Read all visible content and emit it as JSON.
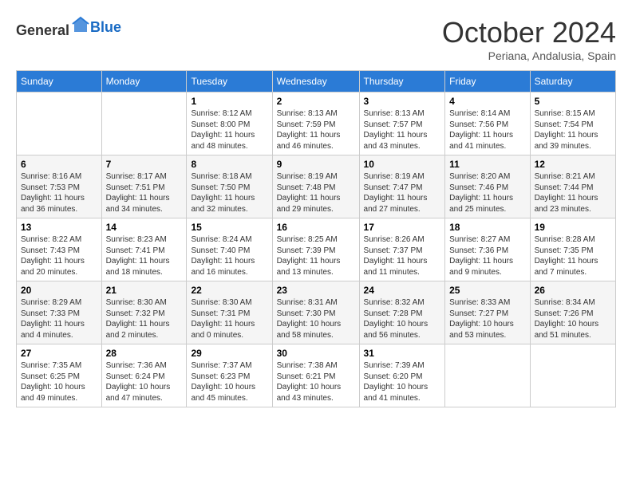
{
  "logo": {
    "text_general": "General",
    "text_blue": "Blue"
  },
  "header": {
    "month": "October 2024",
    "location": "Periana, Andalusia, Spain"
  },
  "columns": [
    "Sunday",
    "Monday",
    "Tuesday",
    "Wednesday",
    "Thursday",
    "Friday",
    "Saturday"
  ],
  "weeks": [
    [
      {
        "day": "",
        "info": ""
      },
      {
        "day": "",
        "info": ""
      },
      {
        "day": "1",
        "info": "Sunrise: 8:12 AM\nSunset: 8:00 PM\nDaylight: 11 hours and 48 minutes."
      },
      {
        "day": "2",
        "info": "Sunrise: 8:13 AM\nSunset: 7:59 PM\nDaylight: 11 hours and 46 minutes."
      },
      {
        "day": "3",
        "info": "Sunrise: 8:13 AM\nSunset: 7:57 PM\nDaylight: 11 hours and 43 minutes."
      },
      {
        "day": "4",
        "info": "Sunrise: 8:14 AM\nSunset: 7:56 PM\nDaylight: 11 hours and 41 minutes."
      },
      {
        "day": "5",
        "info": "Sunrise: 8:15 AM\nSunset: 7:54 PM\nDaylight: 11 hours and 39 minutes."
      }
    ],
    [
      {
        "day": "6",
        "info": "Sunrise: 8:16 AM\nSunset: 7:53 PM\nDaylight: 11 hours and 36 minutes."
      },
      {
        "day": "7",
        "info": "Sunrise: 8:17 AM\nSunset: 7:51 PM\nDaylight: 11 hours and 34 minutes."
      },
      {
        "day": "8",
        "info": "Sunrise: 8:18 AM\nSunset: 7:50 PM\nDaylight: 11 hours and 32 minutes."
      },
      {
        "day": "9",
        "info": "Sunrise: 8:19 AM\nSunset: 7:48 PM\nDaylight: 11 hours and 29 minutes."
      },
      {
        "day": "10",
        "info": "Sunrise: 8:19 AM\nSunset: 7:47 PM\nDaylight: 11 hours and 27 minutes."
      },
      {
        "day": "11",
        "info": "Sunrise: 8:20 AM\nSunset: 7:46 PM\nDaylight: 11 hours and 25 minutes."
      },
      {
        "day": "12",
        "info": "Sunrise: 8:21 AM\nSunset: 7:44 PM\nDaylight: 11 hours and 23 minutes."
      }
    ],
    [
      {
        "day": "13",
        "info": "Sunrise: 8:22 AM\nSunset: 7:43 PM\nDaylight: 11 hours and 20 minutes."
      },
      {
        "day": "14",
        "info": "Sunrise: 8:23 AM\nSunset: 7:41 PM\nDaylight: 11 hours and 18 minutes."
      },
      {
        "day": "15",
        "info": "Sunrise: 8:24 AM\nSunset: 7:40 PM\nDaylight: 11 hours and 16 minutes."
      },
      {
        "day": "16",
        "info": "Sunrise: 8:25 AM\nSunset: 7:39 PM\nDaylight: 11 hours and 13 minutes."
      },
      {
        "day": "17",
        "info": "Sunrise: 8:26 AM\nSunset: 7:37 PM\nDaylight: 11 hours and 11 minutes."
      },
      {
        "day": "18",
        "info": "Sunrise: 8:27 AM\nSunset: 7:36 PM\nDaylight: 11 hours and 9 minutes."
      },
      {
        "day": "19",
        "info": "Sunrise: 8:28 AM\nSunset: 7:35 PM\nDaylight: 11 hours and 7 minutes."
      }
    ],
    [
      {
        "day": "20",
        "info": "Sunrise: 8:29 AM\nSunset: 7:33 PM\nDaylight: 11 hours and 4 minutes."
      },
      {
        "day": "21",
        "info": "Sunrise: 8:30 AM\nSunset: 7:32 PM\nDaylight: 11 hours and 2 minutes."
      },
      {
        "day": "22",
        "info": "Sunrise: 8:30 AM\nSunset: 7:31 PM\nDaylight: 11 hours and 0 minutes."
      },
      {
        "day": "23",
        "info": "Sunrise: 8:31 AM\nSunset: 7:30 PM\nDaylight: 10 hours and 58 minutes."
      },
      {
        "day": "24",
        "info": "Sunrise: 8:32 AM\nSunset: 7:28 PM\nDaylight: 10 hours and 56 minutes."
      },
      {
        "day": "25",
        "info": "Sunrise: 8:33 AM\nSunset: 7:27 PM\nDaylight: 10 hours and 53 minutes."
      },
      {
        "day": "26",
        "info": "Sunrise: 8:34 AM\nSunset: 7:26 PM\nDaylight: 10 hours and 51 minutes."
      }
    ],
    [
      {
        "day": "27",
        "info": "Sunrise: 7:35 AM\nSunset: 6:25 PM\nDaylight: 10 hours and 49 minutes."
      },
      {
        "day": "28",
        "info": "Sunrise: 7:36 AM\nSunset: 6:24 PM\nDaylight: 10 hours and 47 minutes."
      },
      {
        "day": "29",
        "info": "Sunrise: 7:37 AM\nSunset: 6:23 PM\nDaylight: 10 hours and 45 minutes."
      },
      {
        "day": "30",
        "info": "Sunrise: 7:38 AM\nSunset: 6:21 PM\nDaylight: 10 hours and 43 minutes."
      },
      {
        "day": "31",
        "info": "Sunrise: 7:39 AM\nSunset: 6:20 PM\nDaylight: 10 hours and 41 minutes."
      },
      {
        "day": "",
        "info": ""
      },
      {
        "day": "",
        "info": ""
      }
    ]
  ]
}
